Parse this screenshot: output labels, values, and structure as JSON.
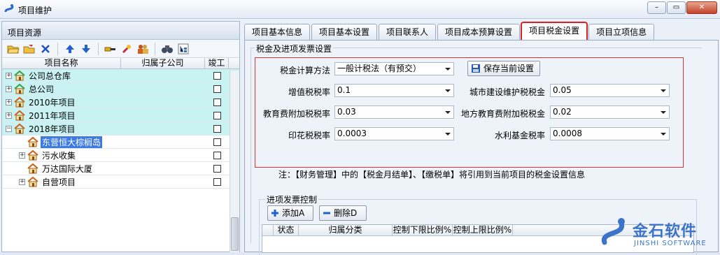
{
  "window": {
    "title": "项目维护",
    "min_label": "–",
    "max_label": "▭",
    "close_label": "✕"
  },
  "left": {
    "header": "项目资源",
    "columns": [
      "项目名称",
      "归属子公司",
      "竣工"
    ],
    "rows": [
      {
        "name": "公司总仓库",
        "expand": "+"
      },
      {
        "name": "总公司",
        "expand": "+"
      },
      {
        "name": "2010年项目",
        "expand": "+"
      },
      {
        "name": "2011年项目",
        "expand": "+"
      },
      {
        "name": "2018年项目",
        "expand": "−"
      },
      {
        "name": "东营恒大棕榈岛",
        "expand": ""
      },
      {
        "name": "污水收集",
        "expand": "+"
      },
      {
        "name": "万达国际大厦",
        "expand": ""
      },
      {
        "name": "自营项目",
        "expand": "+"
      }
    ]
  },
  "tabs": [
    "项目基本信息",
    "项目基本设置",
    "项目联系人",
    "项目成本预算设置",
    "项目税金设置",
    "项目立项信息"
  ],
  "tax": {
    "group_title": "税金及进项发票设置",
    "method_label": "税金计算方法",
    "method_value": "一般计税法（有预交）",
    "save_label": "保存当前设置",
    "vat_label": "增值税税率",
    "vat_value": "0.1",
    "urban_label": "城市建设维护税税金",
    "urban_value": "0.05",
    "edu_label": "教育费附加税税率",
    "edu_value": "0.03",
    "local_edu_label": "地方教育费附加税税金",
    "local_edu_value": "0.02",
    "stamp_label": "印花税税率",
    "stamp_value": "0.0003",
    "water_label": "水利基金税率",
    "water_value": "0.0008",
    "note": "注：【财务管理】中的【税金月结单】、【缴税单】将引用到当前项目的税金设置信息"
  },
  "invoice": {
    "title": "进项发票控制",
    "add_label": "添加A",
    "delete_label": "删除D",
    "columns": [
      "状态",
      "归属分类",
      "控制下限比例%",
      "控制上限比例%"
    ]
  },
  "brand": {
    "name": "金石软件",
    "sub": "JINSHI SOFTWARE"
  }
}
